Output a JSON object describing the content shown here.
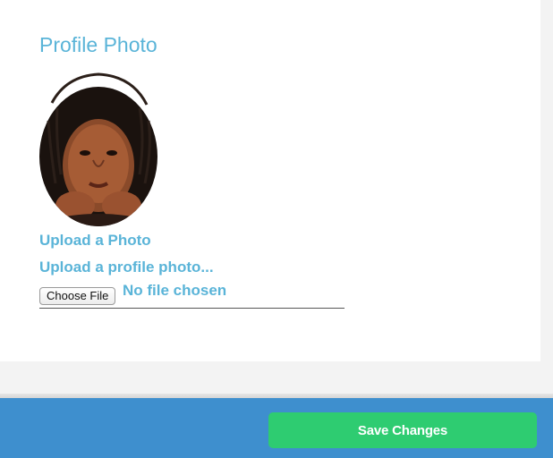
{
  "profile": {
    "title": "Profile Photo",
    "avatar_icon": "profile-photo-portrait"
  },
  "upload": {
    "title": "Upload a Photo",
    "subtitle": "Upload a profile photo...",
    "choose_button_label": "Choose File",
    "status_text": "No file chosen"
  },
  "footer": {
    "save_label": "Save Changes"
  },
  "colors": {
    "accent_text": "#5ab4d8",
    "footer_bg": "#3e8fce",
    "save_button": "#2ecc71"
  }
}
